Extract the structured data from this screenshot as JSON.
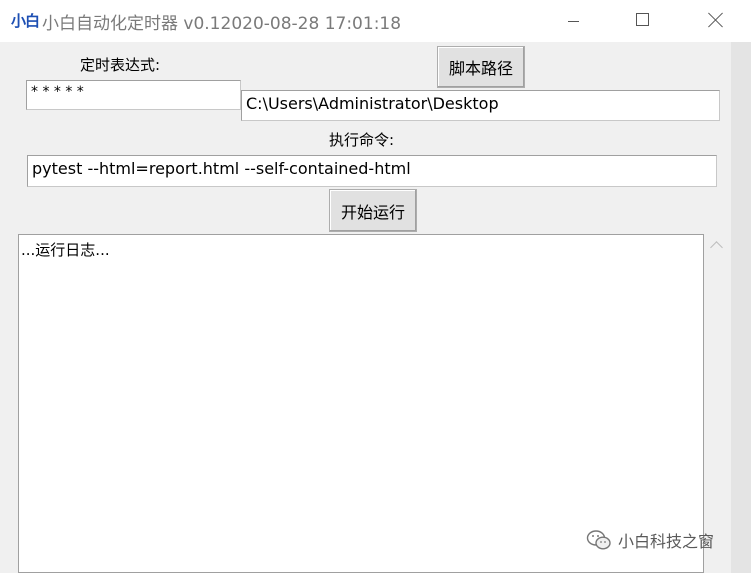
{
  "window": {
    "logo": "小白",
    "title": "小白自动化定时器 v0.12020-08-28 17:01:18"
  },
  "form": {
    "cron_label": "定时表达式:",
    "cron_value": "* * * * *",
    "script_path_button": "脚本路径",
    "script_path_value": "C:\\Users\\Administrator\\Desktop",
    "command_label": "执行命令:",
    "command_value": "pytest --html=report.html --self-contained-html",
    "start_button": "开始运行"
  },
  "log": {
    "text": "...运行日志..."
  },
  "watermark": {
    "text": "小白科技之窗",
    "icon": "wechat-icon"
  },
  "colors": {
    "accent": "#1d4fb3",
    "background": "#f0f0f0"
  }
}
